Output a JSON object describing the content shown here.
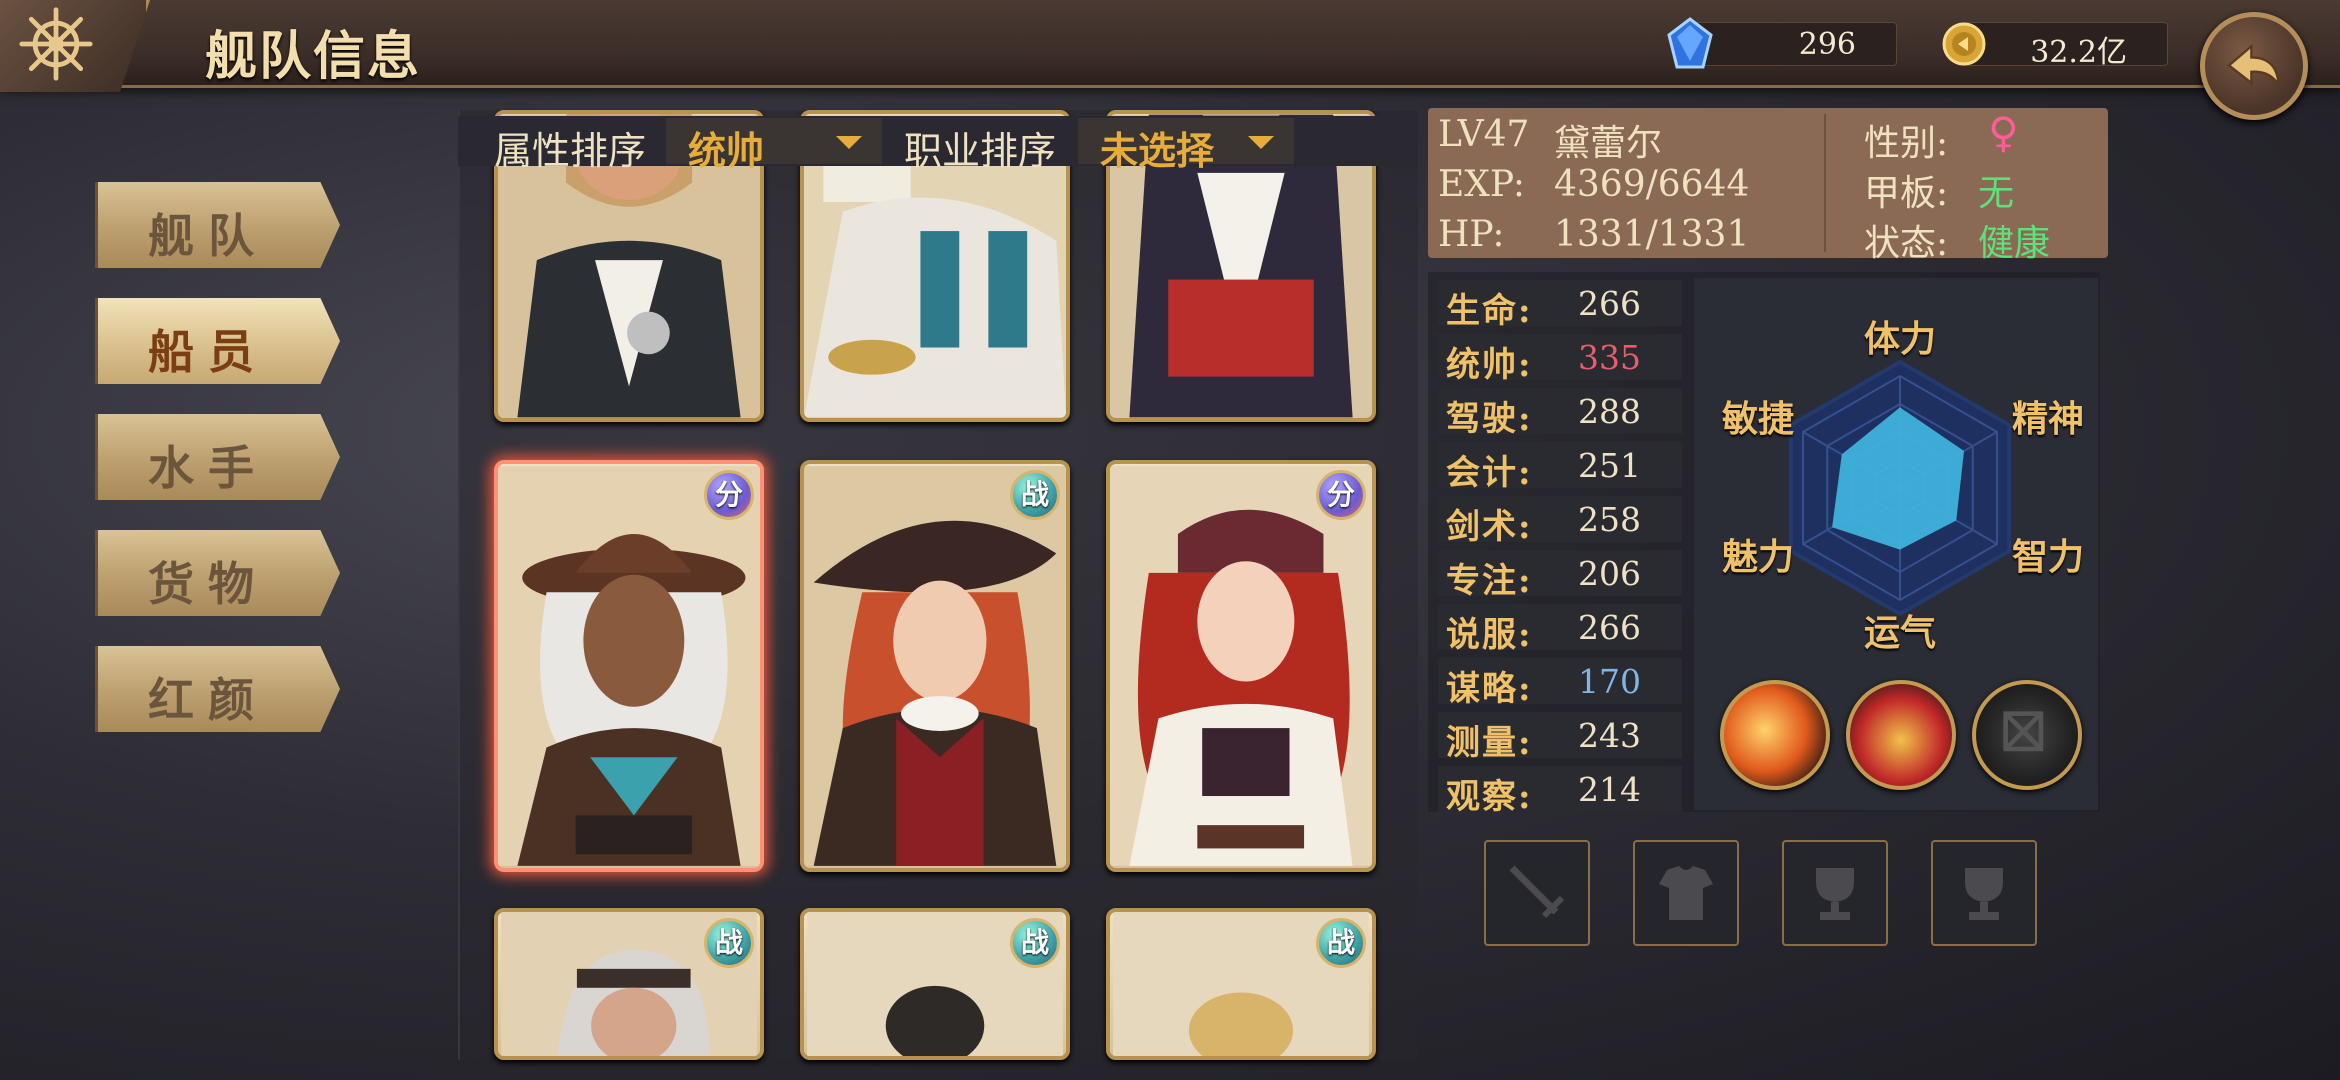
{
  "header": {
    "title": "舰队信息",
    "gems": "296",
    "gold": "32.2亿"
  },
  "menu": [
    {
      "label": "舰队",
      "active": false
    },
    {
      "label": "船员",
      "active": true
    },
    {
      "label": "水手",
      "active": false
    },
    {
      "label": "货物",
      "active": false
    },
    {
      "label": "红颜",
      "active": false
    }
  ],
  "filters": {
    "attr_label": "属性排序",
    "attr_value": "统帅",
    "job_label": "职业排序",
    "job_value": "未选择"
  },
  "cards": [
    {
      "badge": "",
      "type": "none",
      "selected": false
    },
    {
      "badge": "",
      "type": "none",
      "selected": false
    },
    {
      "badge": "",
      "type": "none",
      "selected": false
    },
    {
      "badge": "分",
      "type": "fen",
      "selected": true
    },
    {
      "badge": "战",
      "type": "zhan",
      "selected": false
    },
    {
      "badge": "分",
      "type": "fen",
      "selected": false
    },
    {
      "badge": "战",
      "type": "zhan",
      "selected": false
    },
    {
      "badge": "战",
      "type": "zhan",
      "selected": false
    },
    {
      "badge": "战",
      "type": "zhan",
      "selected": false
    }
  ],
  "character": {
    "level": "LV47",
    "name": "黛蕾尔",
    "exp_label": "EXP:",
    "exp": "4369/6644",
    "hp_label": "HP:",
    "hp": "1331/1331",
    "gender_label": "性别:",
    "gender": "♀",
    "deck_label": "甲板:",
    "deck": "无",
    "status_label": "状态:",
    "status": "健康"
  },
  "stats": [
    {
      "label": "生命:",
      "value": "266",
      "color": "#efe2c4"
    },
    {
      "label": "统帅:",
      "value": "335",
      "color": "#e85d6a"
    },
    {
      "label": "驾驶:",
      "value": "288",
      "color": "#efe2c4"
    },
    {
      "label": "会计:",
      "value": "251",
      "color": "#efe2c4"
    },
    {
      "label": "剑术:",
      "value": "258",
      "color": "#efe2c4"
    },
    {
      "label": "专注:",
      "value": "206",
      "color": "#efe2c4"
    },
    {
      "label": "说服:",
      "value": "266",
      "color": "#efe2c4"
    },
    {
      "label": "谋略:",
      "value": "170",
      "color": "#7fb6e8"
    },
    {
      "label": "测量:",
      "value": "243",
      "color": "#efe2c4"
    },
    {
      "label": "观察:",
      "value": "214",
      "color": "#efe2c4"
    }
  ],
  "radar": {
    "axes": [
      "体力",
      "精神",
      "智力",
      "运气",
      "魅力",
      "敏捷"
    ],
    "levels": [
      0.72,
      0.66,
      0.58,
      0.55,
      0.7,
      0.6
    ]
  },
  "skills": [
    "fire-skill-icon",
    "pirate-hat-skill-icon",
    "locked-skill-icon"
  ],
  "equipment": [
    "sword-slot-icon",
    "armor-slot-icon",
    "trophy-slot-icon",
    "trophy-slot-icon"
  ],
  "colors": {
    "accent": "#e7ad3c",
    "selected": "#ff8f75",
    "radar_fill": "#3fb6e0"
  }
}
